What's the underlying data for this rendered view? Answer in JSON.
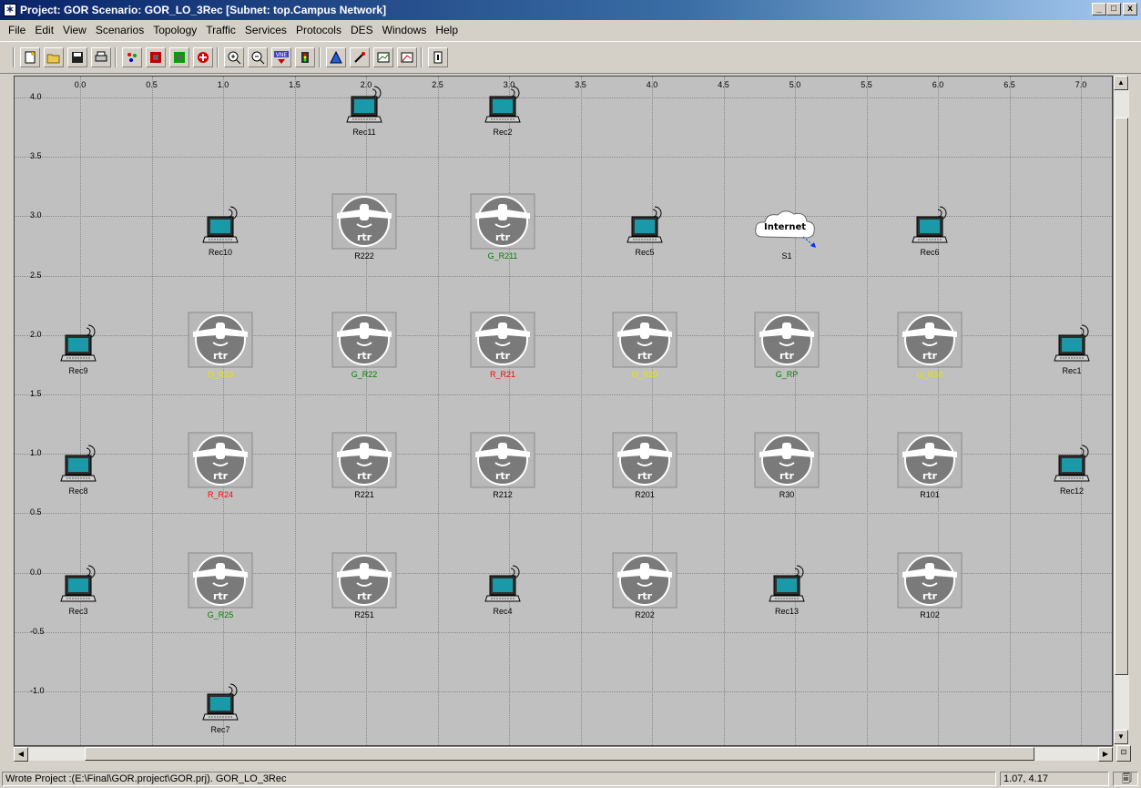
{
  "window": {
    "title": "Project: GOR Scenario: GOR_LO_3Rec  [Subnet: top.Campus Network]",
    "buttons": [
      "_",
      "□",
      "x"
    ]
  },
  "menu": [
    "File",
    "Edit",
    "View",
    "Scenarios",
    "Topology",
    "Traffic",
    "Services",
    "Protocols",
    "DES",
    "Windows",
    "Help"
  ],
  "toolbar": {
    "icons": [
      "new-project-icon",
      "open-icon",
      "save-icon",
      "print-icon",
      "import-icon",
      "fail-node-icon",
      "recover-node-icon",
      "configure-icon",
      "zoom-in-icon",
      "zoom-out-icon",
      "vne-icon",
      "run-des-icon",
      "aggregate-icon",
      "view-results-icon",
      "hide-graphs-icon",
      "edit-attributes-icon",
      "help-icon"
    ],
    "vne_label": "VNE"
  },
  "canvas": {
    "x_ticks": [
      "0.0",
      "0.5",
      "1.0",
      "1.5",
      "2.0",
      "2.5",
      "3.0",
      "3.5",
      "4.0",
      "4.5",
      "5.0",
      "5.5",
      "6.0",
      "6.5",
      "7.0"
    ],
    "y_ticks": [
      "4.0",
      "3.5",
      "3.0",
      "2.5",
      "2.0",
      "1.5",
      "1.0",
      "0.5",
      "0.0",
      "-0.5",
      "-1.0"
    ],
    "router_text": "rtr",
    "cloud_text": "Internet",
    "colors": {
      "green": "#008000",
      "red": "#ff0000",
      "yellow": "#e6e600",
      "black": "#000000"
    },
    "nodes": [
      {
        "label": "Rec11",
        "type": "laptop",
        "color": "black"
      },
      {
        "label": "Rec2",
        "type": "laptop",
        "color": "black"
      },
      {
        "label": "Rec10",
        "type": "laptop",
        "color": "black"
      },
      {
        "label": "R222",
        "type": "router",
        "color": "black"
      },
      {
        "label": "G_R211",
        "type": "router",
        "color": "green"
      },
      {
        "label": "Rec5",
        "type": "laptop",
        "color": "black"
      },
      {
        "label": "S1",
        "type": "cloud",
        "color": "black"
      },
      {
        "label": "Rec6",
        "type": "laptop",
        "color": "black"
      },
      {
        "label": "Rec9",
        "type": "laptop",
        "color": "black"
      },
      {
        "label": "O_R23",
        "type": "router",
        "color": "yellow"
      },
      {
        "label": "G_R22",
        "type": "router",
        "color": "green"
      },
      {
        "label": "R_R21",
        "type": "router",
        "color": "red"
      },
      {
        "label": "O_R20",
        "type": "router",
        "color": "yellow"
      },
      {
        "label": "G_RP",
        "type": "router",
        "color": "green"
      },
      {
        "label": "O_R10",
        "type": "router",
        "color": "yellow"
      },
      {
        "label": "Rec1",
        "type": "laptop",
        "color": "black"
      },
      {
        "label": "Rec8",
        "type": "laptop",
        "color": "black"
      },
      {
        "label": "R_R24",
        "type": "router",
        "color": "red"
      },
      {
        "label": "R221",
        "type": "router",
        "color": "black"
      },
      {
        "label": "R212",
        "type": "router",
        "color": "black"
      },
      {
        "label": "R201",
        "type": "router",
        "color": "black"
      },
      {
        "label": "R30",
        "type": "router",
        "color": "black"
      },
      {
        "label": "R101",
        "type": "router",
        "color": "black"
      },
      {
        "label": "Rec12",
        "type": "laptop",
        "color": "black"
      },
      {
        "label": "Rec3",
        "type": "laptop",
        "color": "black"
      },
      {
        "label": "G_R25",
        "type": "router",
        "color": "green"
      },
      {
        "label": "R251",
        "type": "router",
        "color": "black"
      },
      {
        "label": "Rec4",
        "type": "laptop",
        "color": "black"
      },
      {
        "label": "R202",
        "type": "router",
        "color": "black"
      },
      {
        "label": "Rec13",
        "type": "laptop",
        "color": "black"
      },
      {
        "label": "R102",
        "type": "router",
        "color": "black"
      },
      {
        "label": "Rec7",
        "type": "laptop",
        "color": "black"
      }
    ]
  },
  "status": {
    "message": "Wrote Project :(E:\\Final\\GOR.project\\GOR.prj).  GOR_LO_3Rec",
    "coords": "1.07, 4.17"
  }
}
